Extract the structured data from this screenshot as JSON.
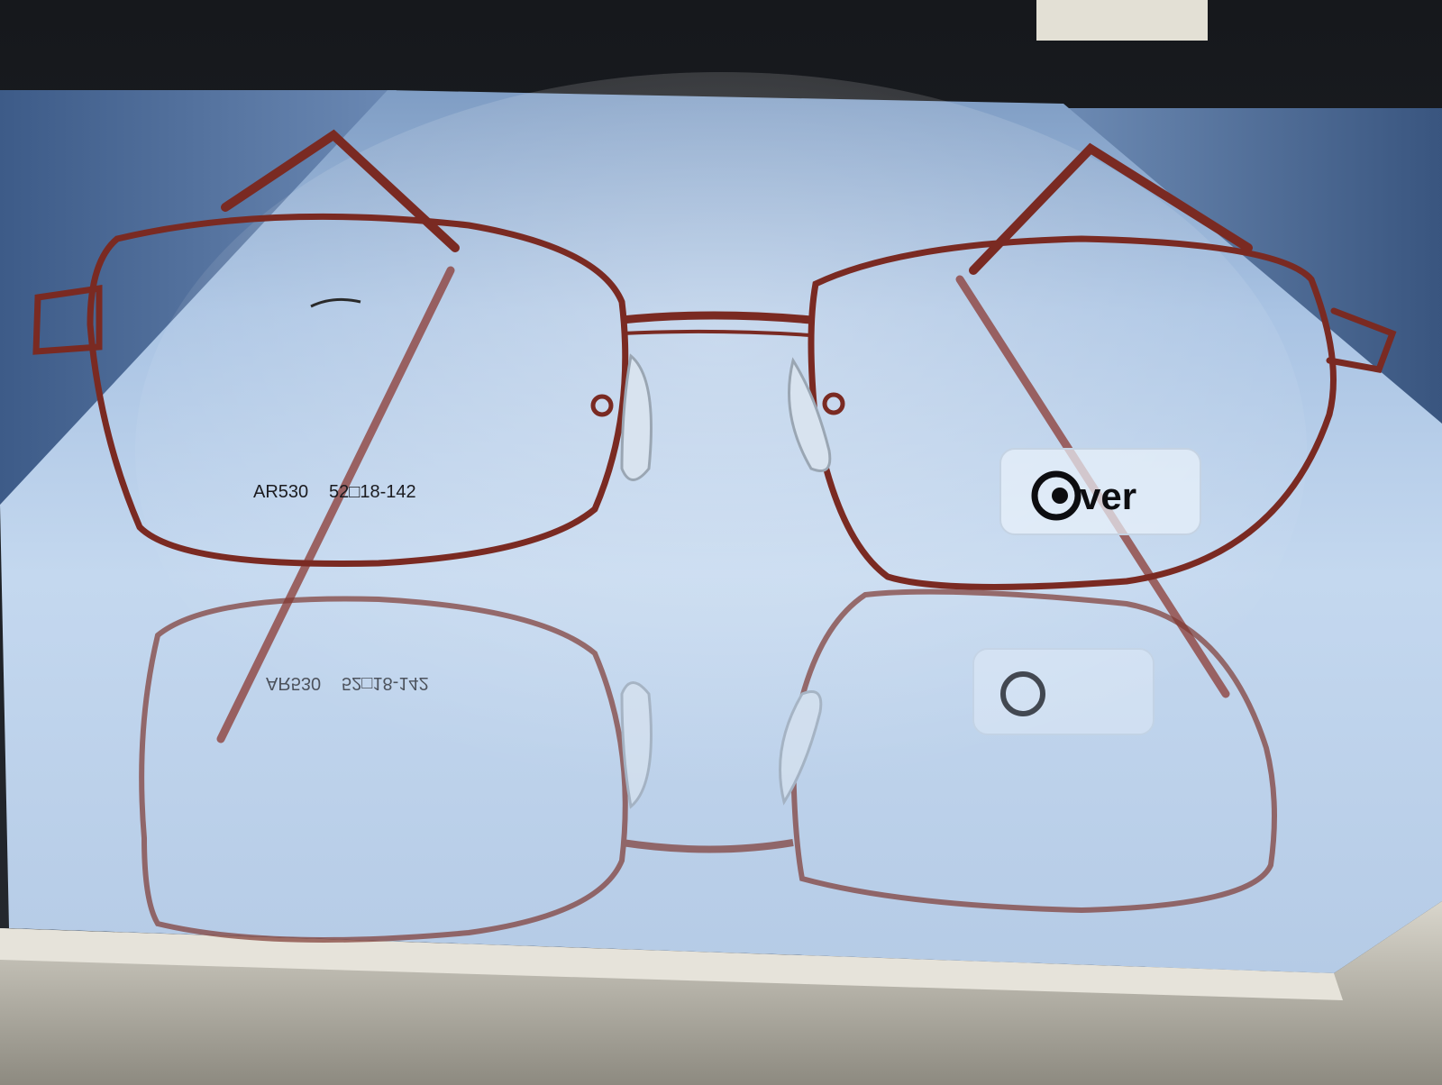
{
  "photo": {
    "subject": "eyeglasses-on-mirror",
    "frame_color": "#7a2a22",
    "lens_print": {
      "model_code": "AR530",
      "size_marking": "52□18-142"
    },
    "brand_sticker": {
      "logo_text": "@ver"
    },
    "reflection_lens_print": {
      "model_code": "AR530",
      "size_marking": "52□18-142"
    }
  }
}
